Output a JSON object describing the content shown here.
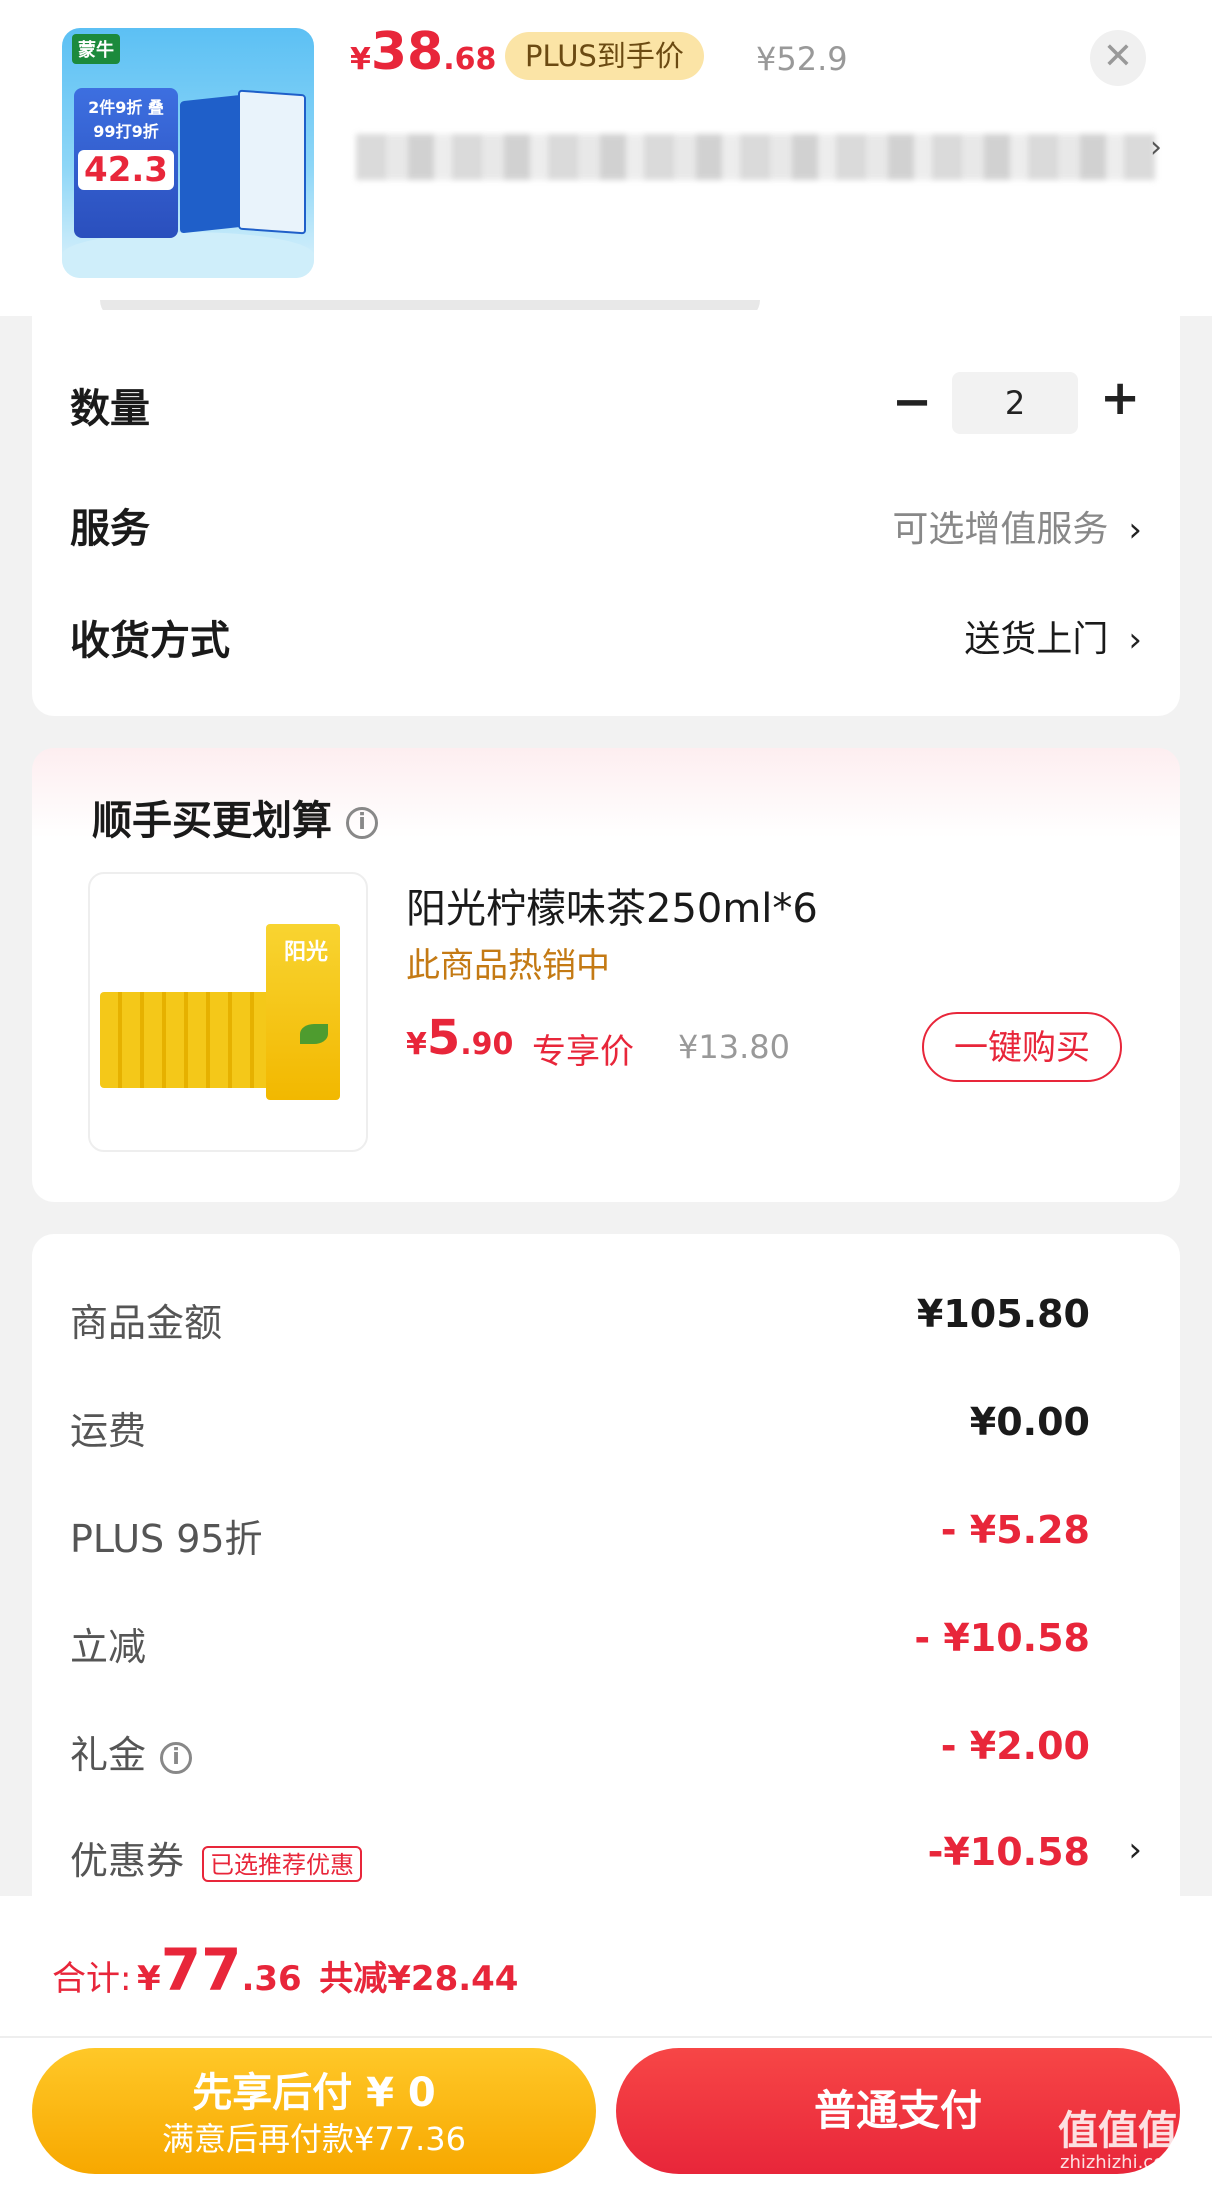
{
  "header": {
    "price_currency": "¥",
    "price_integer": "38",
    "price_decimal": ".68",
    "plus_tag": "PLUS到手价",
    "original_price": "¥52.9",
    "close_icon": "close-icon",
    "thumbnail": {
      "brand": "蒙牛",
      "deal": "2件9折 叠99打9折",
      "price": "42.3"
    }
  },
  "options": {
    "quantity_label": "数量",
    "quantity_value": "2",
    "minus_icon": "minus-icon",
    "plus_icon": "plus-icon",
    "service_label": "服务",
    "service_value": "可选增值服务",
    "delivery_label": "收货方式",
    "delivery_value": "送货上门",
    "chevron_icon": "chevron-right-icon"
  },
  "upsell": {
    "title": "顺手买更划算",
    "info_icon": "info-icon",
    "product_name": "阳光柠檬味茶250ml*6",
    "hot_text": "此商品热销中",
    "price_currency": "¥",
    "price_integer": "5",
    "price_decimal": ".90",
    "exclusive_label": "专享价",
    "original_price": "¥13.80",
    "buy_button": "一键购买",
    "pack_label": "阳光"
  },
  "summary": {
    "rows": [
      {
        "label": "商品金额",
        "value": "¥105.80"
      },
      {
        "label": "运费",
        "value": "¥0.00"
      },
      {
        "label": "PLUS 95折",
        "value": "- ¥5.28"
      },
      {
        "label": "立减",
        "value": "- ¥10.58"
      },
      {
        "label": "礼金",
        "value": "- ¥2.00"
      },
      {
        "label": "优惠券",
        "value": "-¥10.58",
        "tag": "已选推荐优惠"
      }
    ]
  },
  "footer": {
    "total_label": "合计:",
    "total_currency": "¥",
    "total_integer": "77",
    "total_decimal": ".36",
    "total_saved": "共减¥28.44",
    "pay_later_title": "先享后付 ¥ 0",
    "pay_later_sub": "满意后再付款¥77.36",
    "pay_normal": "普通支付",
    "watermark": "值值值",
    "watermark_sub": "zhizhizhi.com"
  },
  "colors": {
    "accent_red": "#e8263a",
    "gold": "#f7a800",
    "hot_orange": "#c47a14",
    "plus_tag_bg": "#fbe4a6"
  }
}
